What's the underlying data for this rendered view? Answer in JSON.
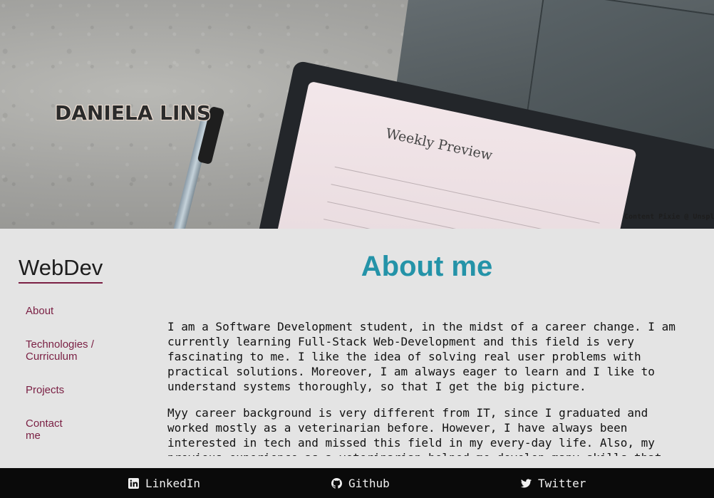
{
  "hero": {
    "title": "DANIELA LINS",
    "notebook_heading": "Weekly Preview",
    "credit": "Content Pixie @ Unsplash"
  },
  "sidebar": {
    "brand": "WebDev",
    "items": [
      {
        "label": "About"
      },
      {
        "label": "Technologies / Curriculum"
      },
      {
        "label": "Projects"
      },
      {
        "label": "Contact me"
      }
    ]
  },
  "main": {
    "heading": "About me",
    "paragraphs": [
      "I am a Software Development student, in the midst of a career change. I am currently learning Full-Stack Web-Development and this field is very fascinating to me. I like the idea of solving real user problems with practical solutions. Moreover, I am always eager to learn and I like to understand systems thoroughly, so that I get the big picture.",
      "Myy career background is very different from IT, since I graduated and worked mostly as a veterinarian before. However, I have always been interested in tech and missed this field in my every-day life. Also, my previous experience as a veterinarian helped me develop many skills that"
    ]
  },
  "footer": {
    "links": [
      {
        "label": "LinkedIn",
        "icon": "linkedin-icon"
      },
      {
        "label": "Github",
        "icon": "github-icon"
      },
      {
        "label": "Twitter",
        "icon": "twitter-icon"
      }
    ]
  },
  "colors": {
    "accent": "#2493a8",
    "nav": "#7a1f43",
    "footer_bg": "#0a0a0a",
    "page_bg": "#e4e4e4"
  }
}
